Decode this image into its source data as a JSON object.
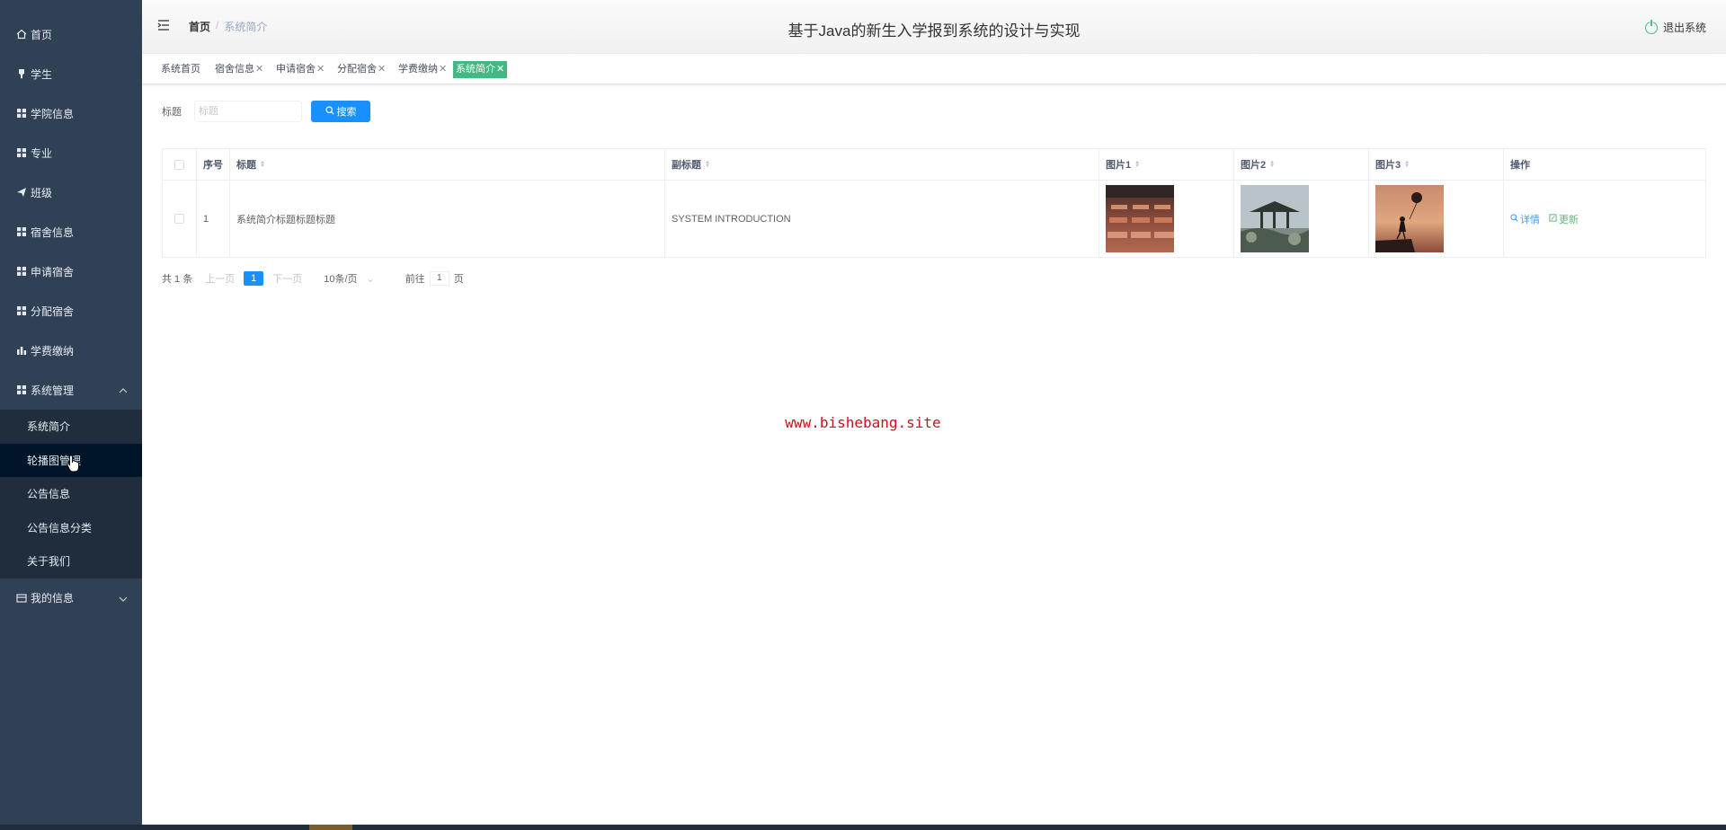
{
  "app": {
    "title": "基于Java的新生入学报到系统的设计与实现",
    "logout_label": "退出系统"
  },
  "breadcrumb": {
    "home": "首页",
    "separator": "/",
    "current": "系统简介"
  },
  "sidebar": {
    "items": [
      {
        "label": "首页",
        "icon": "home-icon"
      },
      {
        "label": "学生",
        "icon": "pin-icon"
      },
      {
        "label": "学院信息",
        "icon": "grid-icon"
      },
      {
        "label": "专业",
        "icon": "grid-icon"
      },
      {
        "label": "班级",
        "icon": "send-icon"
      },
      {
        "label": "宿舍信息",
        "icon": "grid-icon"
      },
      {
        "label": "申请宿舍",
        "icon": "grid-icon"
      },
      {
        "label": "分配宿舍",
        "icon": "grid-icon"
      },
      {
        "label": "学费缴纳",
        "icon": "bar-chart-icon"
      },
      {
        "label": "系统管理",
        "icon": "grid-icon"
      }
    ],
    "submenu": [
      "系统简介",
      "轮播图管理",
      "公告信息",
      "公告信息分类",
      "关于我们"
    ],
    "my_info": "我的信息"
  },
  "tags": [
    {
      "label": "系统首页",
      "closable": false
    },
    {
      "label": "宿舍信息",
      "closable": true
    },
    {
      "label": "申请宿舍",
      "closable": true
    },
    {
      "label": "分配宿舍",
      "closable": true
    },
    {
      "label": "学费缴纳",
      "closable": true
    },
    {
      "label": "系统简介",
      "closable": true,
      "active": true
    }
  ],
  "search": {
    "label": "标题",
    "placeholder": "标题",
    "button": "搜索"
  },
  "table": {
    "headers": [
      "序号",
      "标题",
      "副标题",
      "图片1",
      "图片2",
      "图片3",
      "操作"
    ],
    "rows": [
      {
        "index": "1",
        "title": "系统简介标题标题标题",
        "subtitle": "SYSTEM INTRODUCTION",
        "images": [
          "classroom-photo",
          "pavilion-photo",
          "girl-balloon-photo"
        ]
      }
    ],
    "actions": {
      "detail": "详情",
      "update": "更新"
    }
  },
  "pagination": {
    "total": "共 1 条",
    "prev": "上一页",
    "current": "1",
    "next": "下一页",
    "page_size": "10条/页",
    "goto": "前往",
    "goto_value": "1",
    "page_unit": "页"
  },
  "watermark": "www.bishebang.site",
  "colors": {
    "sidebar_bg": "#304156",
    "submenu_bg": "#1f2d3d",
    "active_tag": "#42b983",
    "primary": "#1890ff"
  }
}
